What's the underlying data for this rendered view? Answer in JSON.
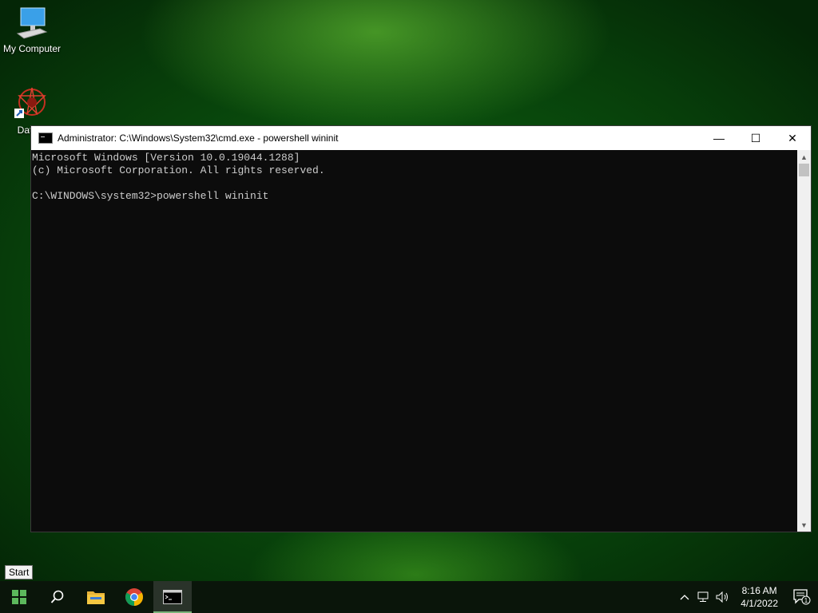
{
  "desktop": {
    "icons": [
      {
        "label": "My Computer",
        "icon": "computer-icon"
      },
      {
        "label": "DataW",
        "icon": "datawatch-icon"
      }
    ]
  },
  "window": {
    "title": "Administrator: C:\\Windows\\System32\\cmd.exe - powershell  wininit",
    "controls": {
      "minimize": "—",
      "maximize": "☐",
      "close": "✕"
    },
    "console_lines": [
      "Microsoft Windows [Version 10.0.19044.1288]",
      "(c) Microsoft Corporation. All rights reserved.",
      "",
      "C:\\WINDOWS\\system32>powershell wininit"
    ]
  },
  "tooltip": {
    "text": "Start"
  },
  "taskbar": {
    "buttons": [
      "start-button",
      "search-button",
      "file-explorer-button",
      "chrome-button",
      "cmd-button"
    ],
    "tray": {
      "time": "8:16 AM",
      "date": "4/1/2022",
      "notification_count": "1"
    }
  },
  "colors": {
    "console_bg": "#0c0c0c",
    "console_text": "#cccccc",
    "accent": "#7ab37a"
  }
}
